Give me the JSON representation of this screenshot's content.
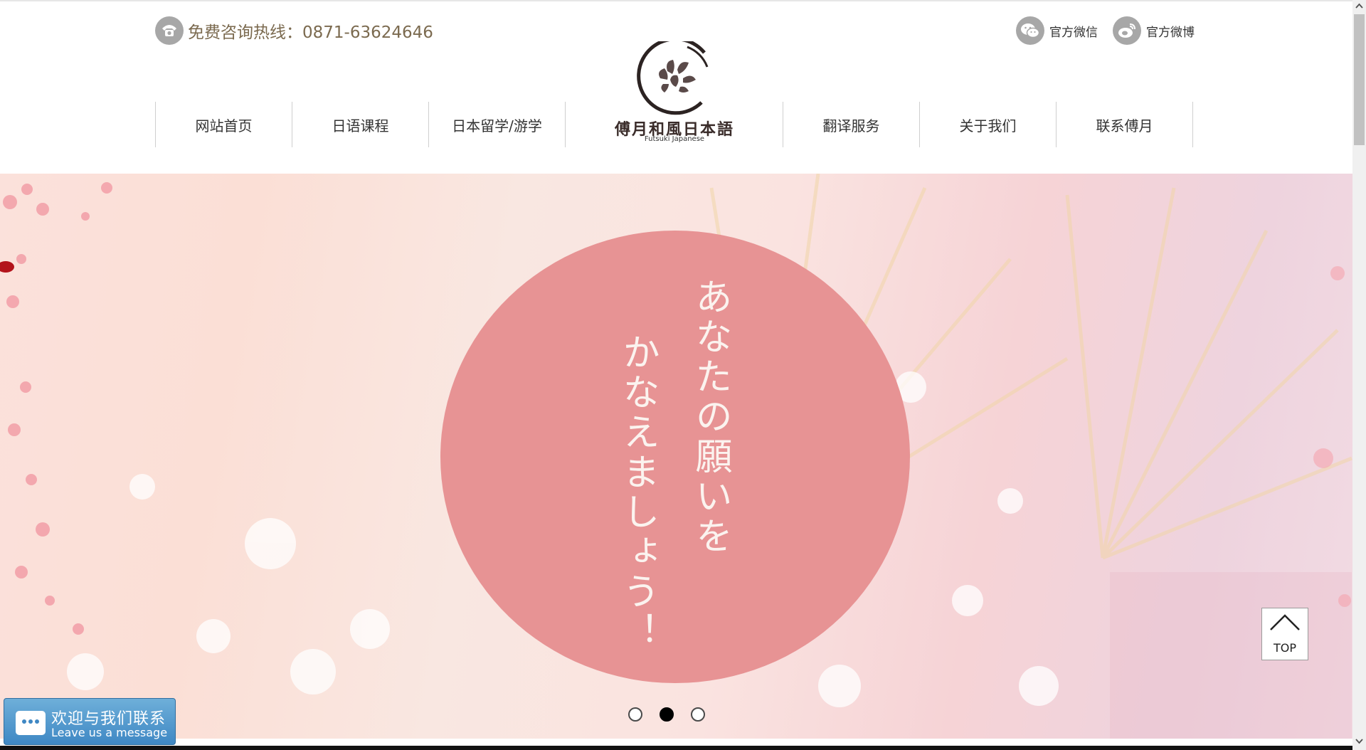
{
  "header": {
    "hotline": "免费咨询热线：0871-63624646",
    "social": [
      {
        "label": "官方微信",
        "icon": "wechat-icon"
      },
      {
        "label": "官方微博",
        "icon": "weibo-icon"
      }
    ]
  },
  "nav": {
    "left": [
      "网站首页",
      "日语课程",
      "日本留学/游学"
    ],
    "right": [
      "翻译服务",
      "关于我们",
      "联系傅月"
    ]
  },
  "logo": {
    "title": "傅月和風日本語",
    "subtitle": "Futsuki Japanese"
  },
  "banner": {
    "slogan_col1": "あなたの願いを",
    "slogan_col2": "かなえましょう！",
    "circle_color": "#e79394",
    "slide_count": 3,
    "active_slide": 2
  },
  "top_button": {
    "label": "TOP"
  },
  "message_button": {
    "title": "欢迎与我们联系",
    "subtitle": "Leave us a message"
  }
}
